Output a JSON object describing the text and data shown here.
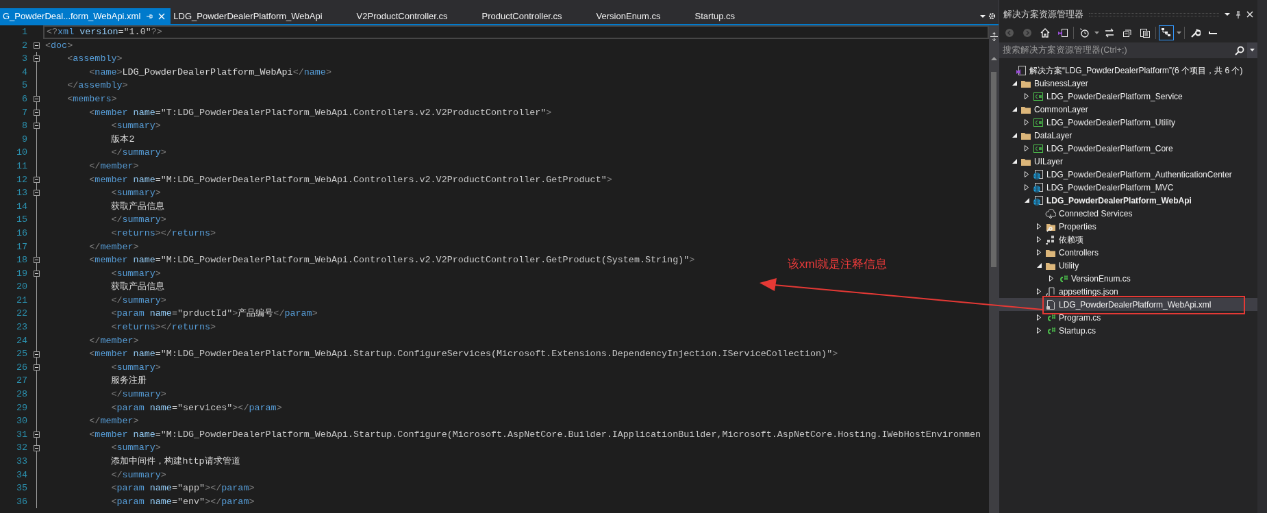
{
  "editor_tabs": [
    {
      "label": "G_PowderDeal...form_WebApi.xml",
      "selected": true
    },
    {
      "label": "LDG_PowderDealerPlatform_WebApi",
      "selected": false
    },
    {
      "label": "V2ProductController.cs",
      "selected": false
    },
    {
      "label": "ProductController.cs",
      "selected": false
    },
    {
      "label": "VersionEnum.cs",
      "selected": false
    },
    {
      "label": "Startup.cs",
      "selected": false
    }
  ],
  "editor": {
    "lines": [
      {
        "number": "1",
        "text": "<?xml version=\"1.0\"?>",
        "fold": false,
        "current": true
      },
      {
        "number": "2",
        "text": "<doc>",
        "fold": true,
        "current": false
      },
      {
        "number": "3",
        "text": "    <assembly>",
        "fold": true,
        "current": false
      },
      {
        "number": "4",
        "text": "        <name>LDG_PowderDealerPlatform_WebApi</name>",
        "fold": false,
        "current": false
      },
      {
        "number": "5",
        "text": "    </assembly>",
        "fold": false,
        "current": false
      },
      {
        "number": "6",
        "text": "    <members>",
        "fold": true,
        "current": false
      },
      {
        "number": "7",
        "text": "        <member name=\"T:LDG_PowderDealerPlatform_WebApi.Controllers.v2.V2ProductController\">",
        "fold": true,
        "current": false
      },
      {
        "number": "8",
        "text": "            <summary>",
        "fold": true,
        "current": false
      },
      {
        "number": "9",
        "text": "            版本2",
        "fold": false,
        "current": false
      },
      {
        "number": "10",
        "text": "            </summary>",
        "fold": false,
        "current": false
      },
      {
        "number": "11",
        "text": "        </member>",
        "fold": false,
        "current": false
      },
      {
        "number": "12",
        "text": "        <member name=\"M:LDG_PowderDealerPlatform_WebApi.Controllers.v2.V2ProductController.GetProduct\">",
        "fold": true,
        "current": false
      },
      {
        "number": "13",
        "text": "            <summary>",
        "fold": true,
        "current": false
      },
      {
        "number": "14",
        "text": "            获取产品信息",
        "fold": false,
        "current": false
      },
      {
        "number": "15",
        "text": "            </summary>",
        "fold": false,
        "current": false
      },
      {
        "number": "16",
        "text": "            <returns></returns>",
        "fold": false,
        "current": false
      },
      {
        "number": "17",
        "text": "        </member>",
        "fold": false,
        "current": false
      },
      {
        "number": "18",
        "text": "        <member name=\"M:LDG_PowderDealerPlatform_WebApi.Controllers.v2.V2ProductController.GetProduct(System.String)\">",
        "fold": true,
        "current": false
      },
      {
        "number": "19",
        "text": "            <summary>",
        "fold": true,
        "current": false
      },
      {
        "number": "20",
        "text": "            获取产品信息",
        "fold": false,
        "current": false
      },
      {
        "number": "21",
        "text": "            </summary>",
        "fold": false,
        "current": false
      },
      {
        "number": "22",
        "text": "            <param name=\"prductId\">产品编号</param>",
        "fold": false,
        "current": false
      },
      {
        "number": "23",
        "text": "            <returns></returns>",
        "fold": false,
        "current": false
      },
      {
        "number": "24",
        "text": "        </member>",
        "fold": false,
        "current": false
      },
      {
        "number": "25",
        "text": "        <member name=\"M:LDG_PowderDealerPlatform_WebApi.Startup.ConfigureServices(Microsoft.Extensions.DependencyInjection.IServiceCollection)\">",
        "fold": true,
        "current": false
      },
      {
        "number": "26",
        "text": "            <summary>",
        "fold": true,
        "current": false
      },
      {
        "number": "27",
        "text": "            服务注册",
        "fold": false,
        "current": false
      },
      {
        "number": "28",
        "text": "            </summary>",
        "fold": false,
        "current": false
      },
      {
        "number": "29",
        "text": "            <param name=\"services\"></param>",
        "fold": false,
        "current": false
      },
      {
        "number": "30",
        "text": "        </member>",
        "fold": false,
        "current": false
      },
      {
        "number": "31",
        "text": "        <member name=\"M:LDG_PowderDealerPlatform_WebApi.Startup.Configure(Microsoft.AspNetCore.Builder.IApplicationBuilder,Microsoft.AspNetCore.Hosting.IWebHostEnvironmen",
        "fold": true,
        "current": false
      },
      {
        "number": "32",
        "text": "            <summary>",
        "fold": true,
        "current": false
      },
      {
        "number": "33",
        "text": "            添加中间件，构建http请求管道",
        "fold": false,
        "current": false
      },
      {
        "number": "34",
        "text": "            </summary>",
        "fold": false,
        "current": false
      },
      {
        "number": "35",
        "text": "            <param name=\"app\"></param>",
        "fold": false,
        "current": false
      },
      {
        "number": "36",
        "text": "            <param name=\"env\"></param>",
        "fold": false,
        "current": false
      }
    ]
  },
  "solution_explorer": {
    "title": "解决方案资源管理器",
    "search": {
      "placeholder": "搜索解决方案资源管理器(Ctrl+;)"
    },
    "tree": [
      {
        "label": "解决方案“LDG_PowderDealerPlatform”(6 个项目，共 6 个)",
        "kind": "solution",
        "expandable": false,
        "selected": false,
        "bold": false,
        "children": [
          {
            "label": "BuisnessLayer",
            "kind": "folder",
            "expandable": true,
            "expanded": true,
            "selected": false,
            "bold": false,
            "children": [
              {
                "label": "LDG_PowderDealerPlatform_Service",
                "kind": "csproject",
                "expandable": true,
                "expanded": false,
                "selected": false,
                "bold": false
              }
            ]
          },
          {
            "label": "CommonLayer",
            "kind": "folder",
            "expandable": true,
            "expanded": true,
            "selected": false,
            "bold": false,
            "children": [
              {
                "label": "LDG_PowderDealerPlatform_Utility",
                "kind": "csproject",
                "expandable": true,
                "expanded": false,
                "selected": false,
                "bold": false
              }
            ]
          },
          {
            "label": "DataLayer",
            "kind": "folder",
            "expandable": true,
            "expanded": true,
            "selected": false,
            "bold": false,
            "children": [
              {
                "label": "LDG_PowderDealerPlatform_Core",
                "kind": "csproject",
                "expandable": true,
                "expanded": false,
                "selected": false,
                "bold": false
              }
            ]
          },
          {
            "label": "UILayer",
            "kind": "folder",
            "expandable": true,
            "expanded": true,
            "selected": false,
            "bold": false,
            "children": [
              {
                "label": "LDG_PowderDealerPlatform_AuthenticationCenter",
                "kind": "webproject",
                "expandable": true,
                "expanded": false,
                "selected": false,
                "bold": false
              },
              {
                "label": "LDG_PowderDealerPlatform_MVC",
                "kind": "webproject",
                "expandable": true,
                "expanded": false,
                "selected": false,
                "bold": false
              },
              {
                "label": "LDG_PowderDealerPlatform_WebApi",
                "kind": "webproject",
                "expandable": true,
                "expanded": true,
                "selected": false,
                "bold": true,
                "children": [
                  {
                    "label": "Connected Services",
                    "kind": "cloud",
                    "expandable": false,
                    "selected": false,
                    "bold": false
                  },
                  {
                    "label": "Properties",
                    "kind": "properties",
                    "expandable": true,
                    "expanded": false,
                    "selected": false,
                    "bold": false
                  },
                  {
                    "label": "依赖项",
                    "kind": "dependencies",
                    "expandable": true,
                    "expanded": false,
                    "selected": false,
                    "bold": false
                  },
                  {
                    "label": "Controllers",
                    "kind": "folder",
                    "expandable": true,
                    "expanded": false,
                    "selected": false,
                    "bold": false
                  },
                  {
                    "label": "Utility",
                    "kind": "folder",
                    "expandable": true,
                    "expanded": true,
                    "selected": false,
                    "bold": false,
                    "children": [
                      {
                        "label": "VersionEnum.cs",
                        "kind": "csfile",
                        "expandable": true,
                        "expanded": false,
                        "selected": false,
                        "bold": false
                      }
                    ]
                  },
                  {
                    "label": "appsettings.json",
                    "kind": "json",
                    "expandable": true,
                    "expanded": false,
                    "selected": false,
                    "bold": false
                  },
                  {
                    "label": "LDG_PowderDealerPlatform_WebApi.xml",
                    "kind": "xml",
                    "expandable": false,
                    "selected": true,
                    "bold": false
                  },
                  {
                    "label": "Program.cs",
                    "kind": "csfile",
                    "expandable": true,
                    "expanded": false,
                    "selected": false,
                    "bold": false
                  },
                  {
                    "label": "Startup.cs",
                    "kind": "csfile",
                    "expandable": true,
                    "expanded": false,
                    "selected": false,
                    "bold": false
                  }
                ]
              }
            ]
          }
        ]
      }
    ]
  },
  "annotation": {
    "text": "该xml就是注释信息"
  }
}
